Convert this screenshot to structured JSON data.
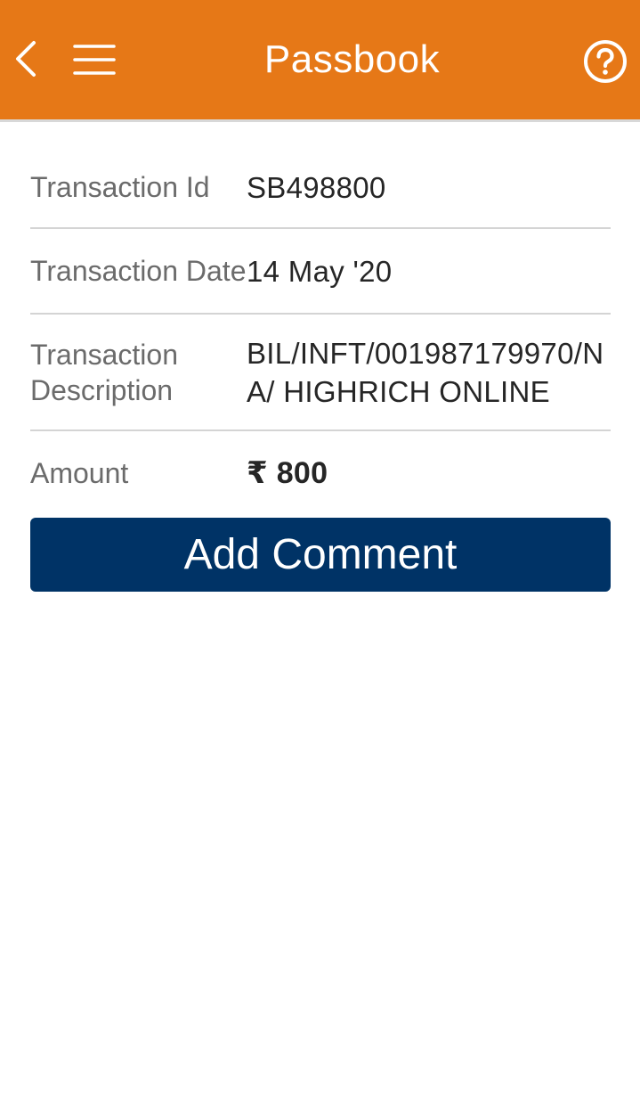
{
  "header": {
    "title": "Passbook",
    "back_icon": "chevron-left-icon",
    "menu_icon": "hamburger-menu-icon",
    "help_icon": "help-circle-icon"
  },
  "transaction": {
    "id_label": "Transaction Id",
    "id_value": "SB498800",
    "date_label": "Transaction Date",
    "date_value": "14 May '20",
    "description_label": "Transaction Description",
    "description_value": "BIL/INFT/001987179970/NA/ HIGHRICH ONLINE",
    "amount_label": "Amount",
    "amount_value": "₹ 800"
  },
  "actions": {
    "add_comment_label": "Add Comment"
  },
  "colors": {
    "header_bg": "#e67817",
    "primary_button": "#003366"
  }
}
